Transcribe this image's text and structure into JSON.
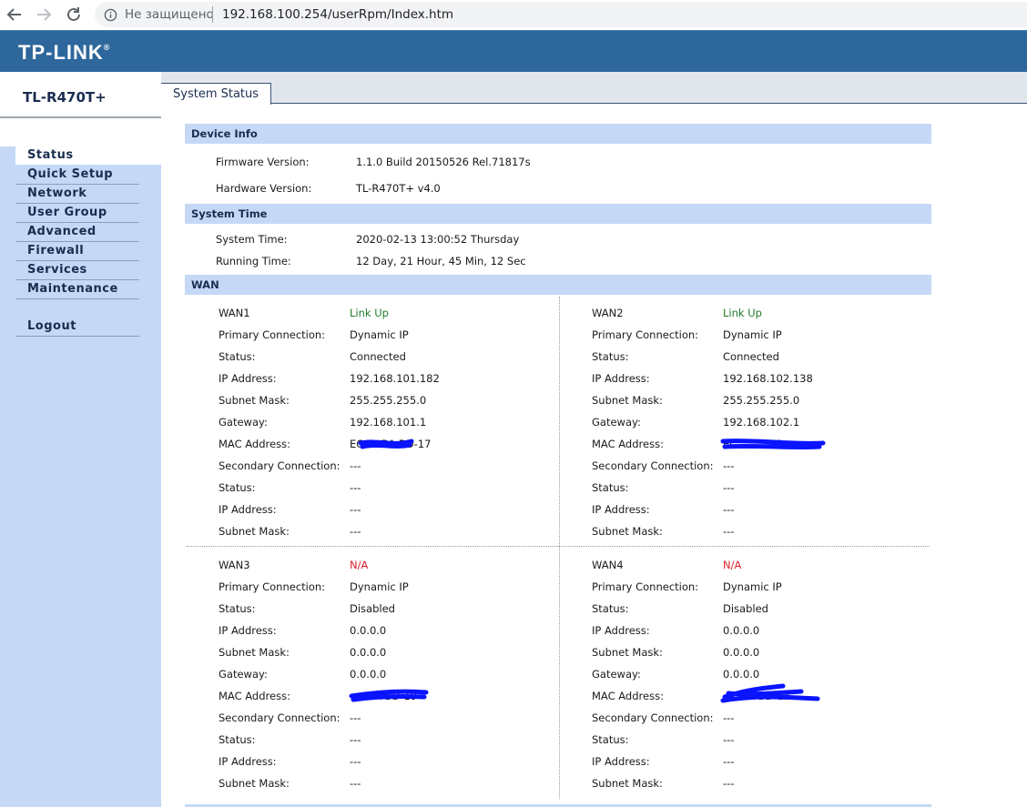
{
  "browser": {
    "not_secure": "Не защищено",
    "url": "192.168.100.254/userRpm/Index.htm"
  },
  "header": {
    "logo": "TP-LINK",
    "logo_mark": "®"
  },
  "model": "TL-R470T+",
  "menu": {
    "items": [
      "Status",
      "Quick Setup",
      "Network",
      "User Group",
      "Advanced",
      "Firewall",
      "Services",
      "Maintenance"
    ],
    "logout": "Logout"
  },
  "tab": "System Status",
  "device_info": {
    "title": "Device Info",
    "firmware_label": "Firmware Version:",
    "firmware_value": "1.1.0 Build 20150526 Rel.71817s",
    "hardware_label": "Hardware Version:",
    "hardware_value": "TL-R470T+ v4.0"
  },
  "system_time": {
    "title": "System Time",
    "time_label": "System Time:",
    "time_value": "2020-02-13 13:00:52 Thursday",
    "running_label": "Running Time:",
    "running_value": "12 Day, 21 Hour, 45 Min, 12 Sec"
  },
  "wan_title": "WAN",
  "wan_labels": [
    "Primary Connection:",
    "Status:",
    "IP Address:",
    "Subnet Mask:",
    "Gateway:",
    "MAC Address:",
    "Secondary Connection:",
    "Status:",
    "IP Address:",
    "Subnet Mask:"
  ],
  "wans": [
    {
      "name": "WAN1",
      "state": "Link Up",
      "state_color": "#207a2c",
      "values": [
        "Dynamic IP",
        "Connected",
        "192.168.101.182",
        "255.255.255.0",
        "192.168.101.1",
        "EC-  -  -BA-BD-17",
        "---",
        "---",
        "---",
        "---"
      ]
    },
    {
      "name": "WAN2",
      "state": "Link Up",
      "state_color": "#207a2c",
      "values": [
        "Dynamic IP",
        "Connected",
        "192.168.102.138",
        "255.255.255.0",
        "192.168.102.1",
        "EC-  -  -  -  -18",
        "---",
        "---",
        "---",
        "---"
      ]
    },
    {
      "name": "WAN3",
      "state": "N/A",
      "state_color": "#e0202a",
      "values": [
        "Dynamic IP",
        "Disabled",
        "0.0.0.0",
        "0.0.0.0",
        "0.0.0.0",
        "  -  -  -BA-BD-19",
        "---",
        "---",
        "---",
        "---"
      ]
    },
    {
      "name": "WAN4",
      "state": "N/A",
      "state_color": "#e0202a",
      "values": [
        "Dynamic IP",
        "Disabled",
        "0.0.0.0",
        "0.0.0.0",
        "0.0.0.0",
        "  -  -  -BA-BD-1A",
        "---",
        "---",
        "---",
        "---"
      ]
    }
  ],
  "colors": {
    "header_blue": "#2e679b",
    "menu_bg": "#c5d9f7",
    "section_bg": "#c5d9f7",
    "redaction": "#0a14ff"
  }
}
